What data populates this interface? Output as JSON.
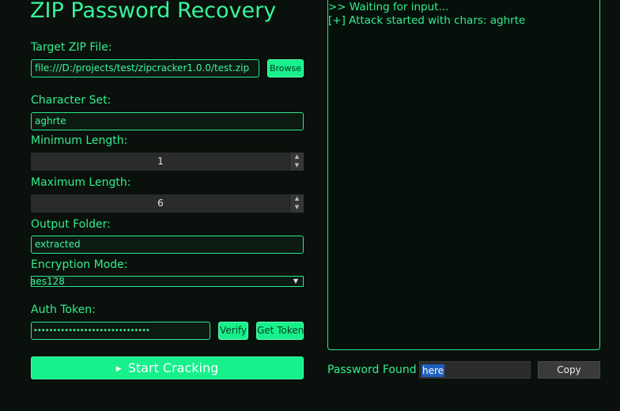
{
  "app": {
    "title": "ZIP Password Recovery"
  },
  "form": {
    "target_label": "Target ZIP File:",
    "target_value": "file:///D:/projects/test/zipcracker1.0.0/test.zip",
    "browse_label": "Browse",
    "charset_label": "Character Set:",
    "charset_value": "aghrte",
    "min_label": "Minimum Length:",
    "min_value": "1",
    "max_label": "Maximum Length:",
    "max_value": "6",
    "output_label": "Output Folder:",
    "output_value": "extracted",
    "encryption_label": "Encryption Mode:",
    "encryption_value": "aes128",
    "auth_label": "Auth Token:",
    "auth_value": "••••••••••••••••••••••••••••••",
    "verify_label": "Verify",
    "get_token_label": "Get Token",
    "start_label": "Start Cracking",
    "start_icon": "play-icon"
  },
  "console": {
    "lines": [
      ">> Waiting for input...",
      "[+] Attack started with chars: aghrte"
    ]
  },
  "result": {
    "label": "Password Found",
    "value": "here",
    "copy_label": "Copy"
  },
  "colors": {
    "accent": "#17f08b",
    "background": "#0a110c",
    "text": "#33ee8e",
    "selection": "#1f5fbf"
  }
}
